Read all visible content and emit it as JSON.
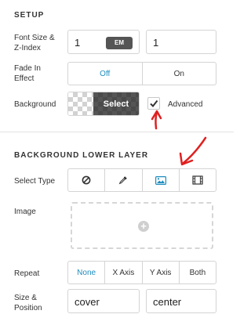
{
  "setup": {
    "title": "SETUP",
    "font_size_label": "Font Size & Z-Index",
    "font_size_value": "1",
    "font_size_unit": "EM",
    "z_index_value": "1",
    "fade_label": "Fade In Effect",
    "fade_options": [
      "Off",
      "On"
    ],
    "fade_selected": "Off",
    "background_label": "Background",
    "select_label": "Select",
    "advanced_label": "Advanced",
    "advanced_checked": true
  },
  "lower_layer": {
    "title": "BACKGROUND LOWER LAYER",
    "select_type_label": "Select Type",
    "type_icons": [
      "none-icon",
      "eyedropper-icon",
      "image-icon",
      "film-icon"
    ],
    "type_selected": "image-icon",
    "image_label": "Image",
    "repeat_label": "Repeat",
    "repeat_options": [
      "None",
      "X Axis",
      "Y Axis",
      "Both"
    ],
    "repeat_selected": "None",
    "size_position_label": "Size & Position",
    "size_value": "cover",
    "position_value": "center"
  },
  "colors": {
    "accent": "#1e8cbe",
    "annotation": "#e02020"
  }
}
